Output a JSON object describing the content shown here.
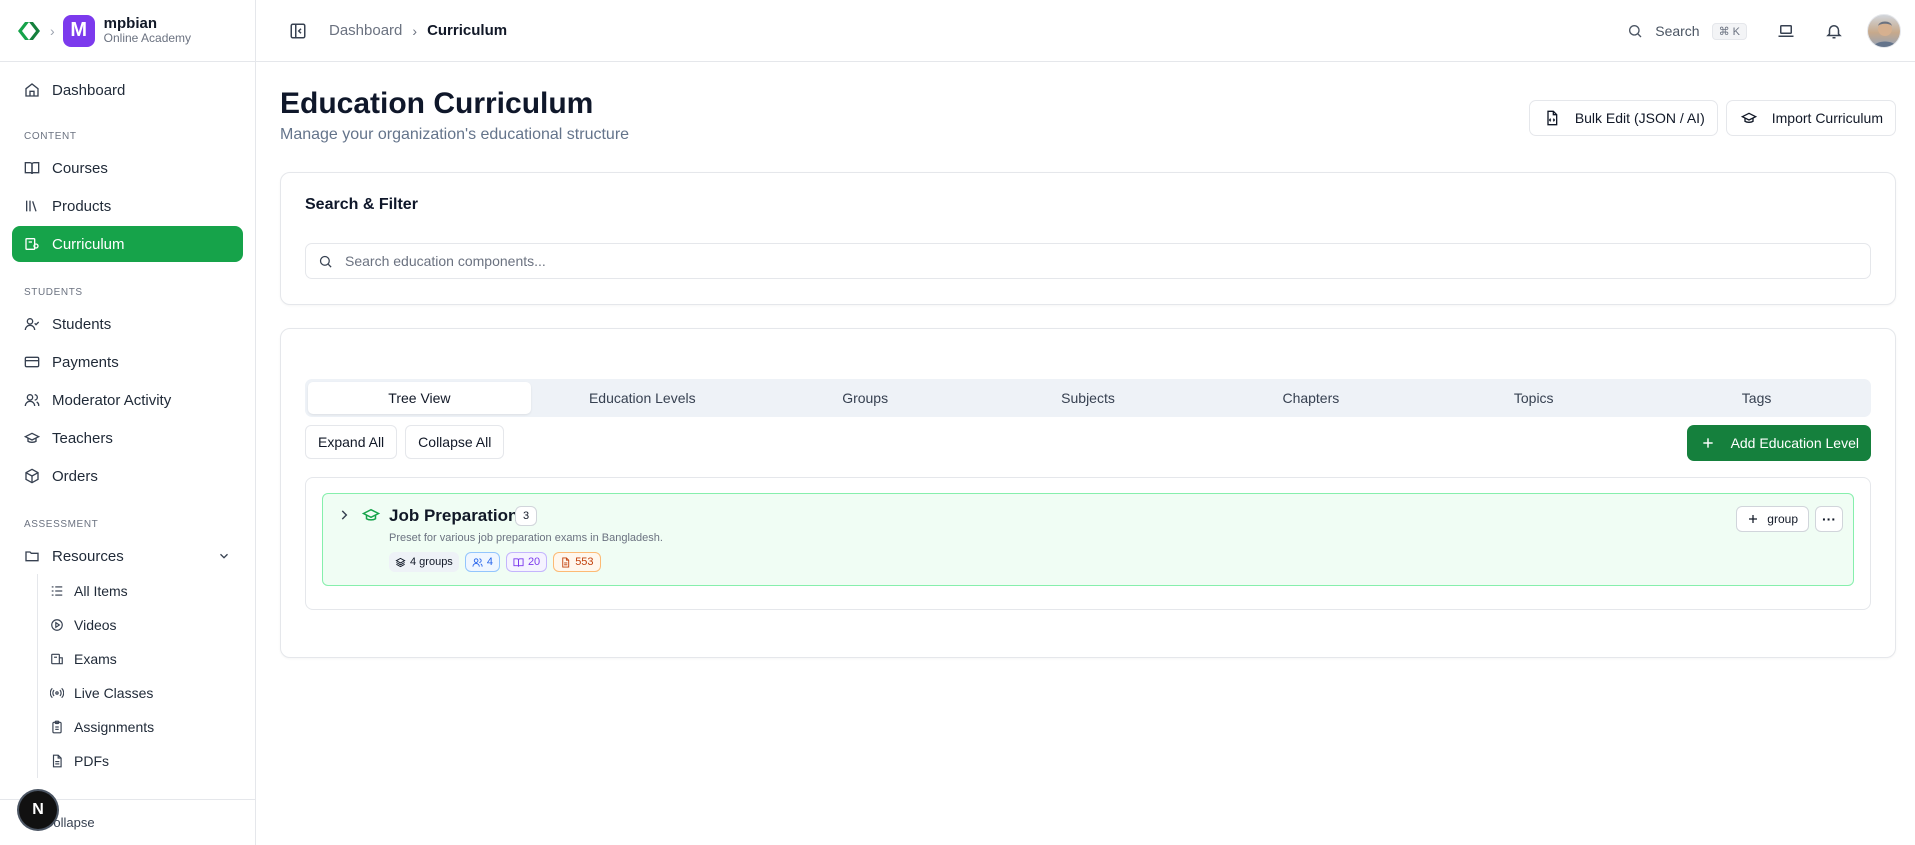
{
  "brand": {
    "org_initial": "M",
    "org_name": "mpbian",
    "org_subtitle": "Online Academy",
    "accent_color": "#16a34a",
    "org_color": "#7c3aed"
  },
  "sidebar": {
    "top_items": [
      {
        "label": "Dashboard",
        "icon": "home-icon"
      }
    ],
    "sections": [
      {
        "label": "CONTENT",
        "items": [
          {
            "label": "Courses",
            "icon": "book-open-icon"
          },
          {
            "label": "Products",
            "icon": "library-icon"
          },
          {
            "label": "Curriculum",
            "icon": "curriculum-icon",
            "active": true
          }
        ]
      },
      {
        "label": "STUDENTS",
        "items": [
          {
            "label": "Students",
            "icon": "user-check-icon"
          },
          {
            "label": "Payments",
            "icon": "credit-card-icon"
          },
          {
            "label": "Moderator Activity",
            "icon": "users-icon"
          },
          {
            "label": "Teachers",
            "icon": "graduation-cap-icon"
          },
          {
            "label": "Orders",
            "icon": "package-icon"
          }
        ]
      },
      {
        "label": "ASSESSMENT",
        "group_label": "Resources",
        "sub_items": [
          {
            "label": "All Items",
            "icon": "list-icon"
          },
          {
            "label": "Videos",
            "icon": "play-circle-icon"
          },
          {
            "label": "Exams",
            "icon": "exam-icon"
          },
          {
            "label": "Live Classes",
            "icon": "radio-icon"
          },
          {
            "label": "Assignments",
            "icon": "clipboard-icon"
          },
          {
            "label": "PDFs",
            "icon": "file-text-icon"
          }
        ]
      }
    ],
    "footer_label": "Collapse",
    "floating_badge": "N"
  },
  "topbar": {
    "breadcrumb": [
      "Dashboard",
      "Curriculum"
    ],
    "search_label": "Search",
    "search_shortcut": "⌘ K"
  },
  "page": {
    "title": "Education Curriculum",
    "subtitle": "Manage your organization's educational structure",
    "bulk_edit_label": "Bulk Edit (JSON / AI)",
    "import_label": "Import Curriculum"
  },
  "filter": {
    "title": "Search & Filter",
    "placeholder": "Search education components..."
  },
  "tabs": [
    "Tree View",
    "Education Levels",
    "Groups",
    "Subjects",
    "Chapters",
    "Topics",
    "Tags"
  ],
  "active_tab": 0,
  "tree": {
    "expand_all": "Expand All",
    "collapse_all": "Collapse All",
    "add_level": "Add Education Level",
    "nodes": [
      {
        "title": "Job Preparation",
        "count": "3",
        "description": "Preset for various job preparation exams in Bangladesh.",
        "badges": {
          "groups": "4 groups",
          "users": "4",
          "subjects": "20",
          "items": "553"
        },
        "add_group_label": "group",
        "more_label": "···"
      }
    ]
  }
}
